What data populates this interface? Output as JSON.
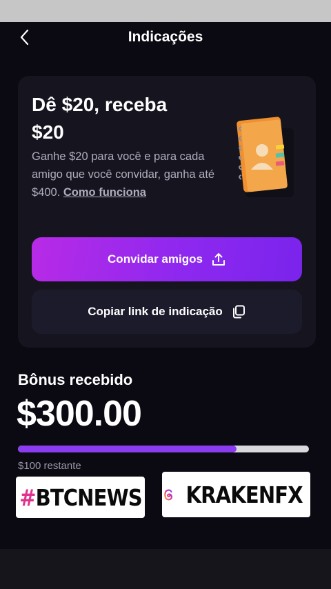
{
  "header": {
    "title": "Indicações"
  },
  "promo": {
    "title": "Dê $20, receba $20",
    "description": "Ganhe $20 para você e para cada amigo que você convidar, ganha até $400.",
    "how_link": "Como funciona",
    "invite_button": "Convidar amigos",
    "copy_button": "Copiar link de indicação"
  },
  "bonus": {
    "label": "Bônus recebido",
    "amount": "$300.00",
    "progress_fraction": 0.75,
    "remaining": "$100 restante"
  },
  "overlays": {
    "tag_left_hash": "#",
    "tag_left_text": "BTCNEWS",
    "tag_right_text": "KRAKENFX"
  },
  "colors": {
    "accent": "#8b3cf1",
    "background": "#0b0a12",
    "card": "#16151f"
  },
  "icons": [
    "chevron-left-icon",
    "share-upload-icon",
    "copy-icon",
    "notebook-contacts-icon",
    "threads-icon"
  ]
}
